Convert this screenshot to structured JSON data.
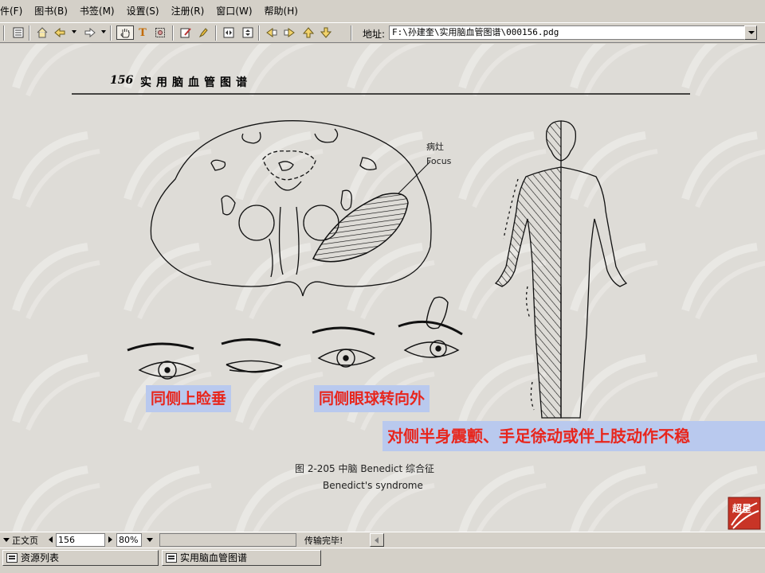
{
  "menubar": {
    "items": [
      {
        "label": "件(F)"
      },
      {
        "label": "图书(B)"
      },
      {
        "label": "书签(M)"
      },
      {
        "label": "设置(S)"
      },
      {
        "label": "注册(R)"
      },
      {
        "label": "窗口(W)"
      },
      {
        "label": "帮助(H)"
      }
    ]
  },
  "toolbar": {
    "address_label": "地址:",
    "address_value": "F:\\孙建奎\\实用脑血管图谱\\000156.pdg"
  },
  "page": {
    "header_number": "156",
    "header_title": "实用脑血管图谱",
    "brainstem_label_cn": "病灶",
    "brainstem_label_en": "Focus",
    "caption_ptosis": "同侧上睑垂",
    "caption_eye_deviation": "同侧眼球转向外",
    "caption_tremor": "对侧半身震颤、手足徐动或伴上肢动作不稳",
    "figure_caption_cn": "图 2-205  中脑 Benedict 综合征",
    "figure_caption_en": "Benedict's syndrome",
    "logo_text": "超星"
  },
  "statusbar": {
    "mode_label": "正文页",
    "page_value": "156",
    "zoom_value": "80%",
    "status_text": "传输完毕!"
  },
  "taskbar": {
    "items": [
      {
        "label": "资源列表"
      },
      {
        "label": "实用脑血管图谱"
      }
    ]
  },
  "colors": {
    "caption_text": "#e8261d",
    "caption_bg": "#b9c9ee",
    "page_bg": "#dedcd7",
    "chrome": "#d4d0c8"
  }
}
